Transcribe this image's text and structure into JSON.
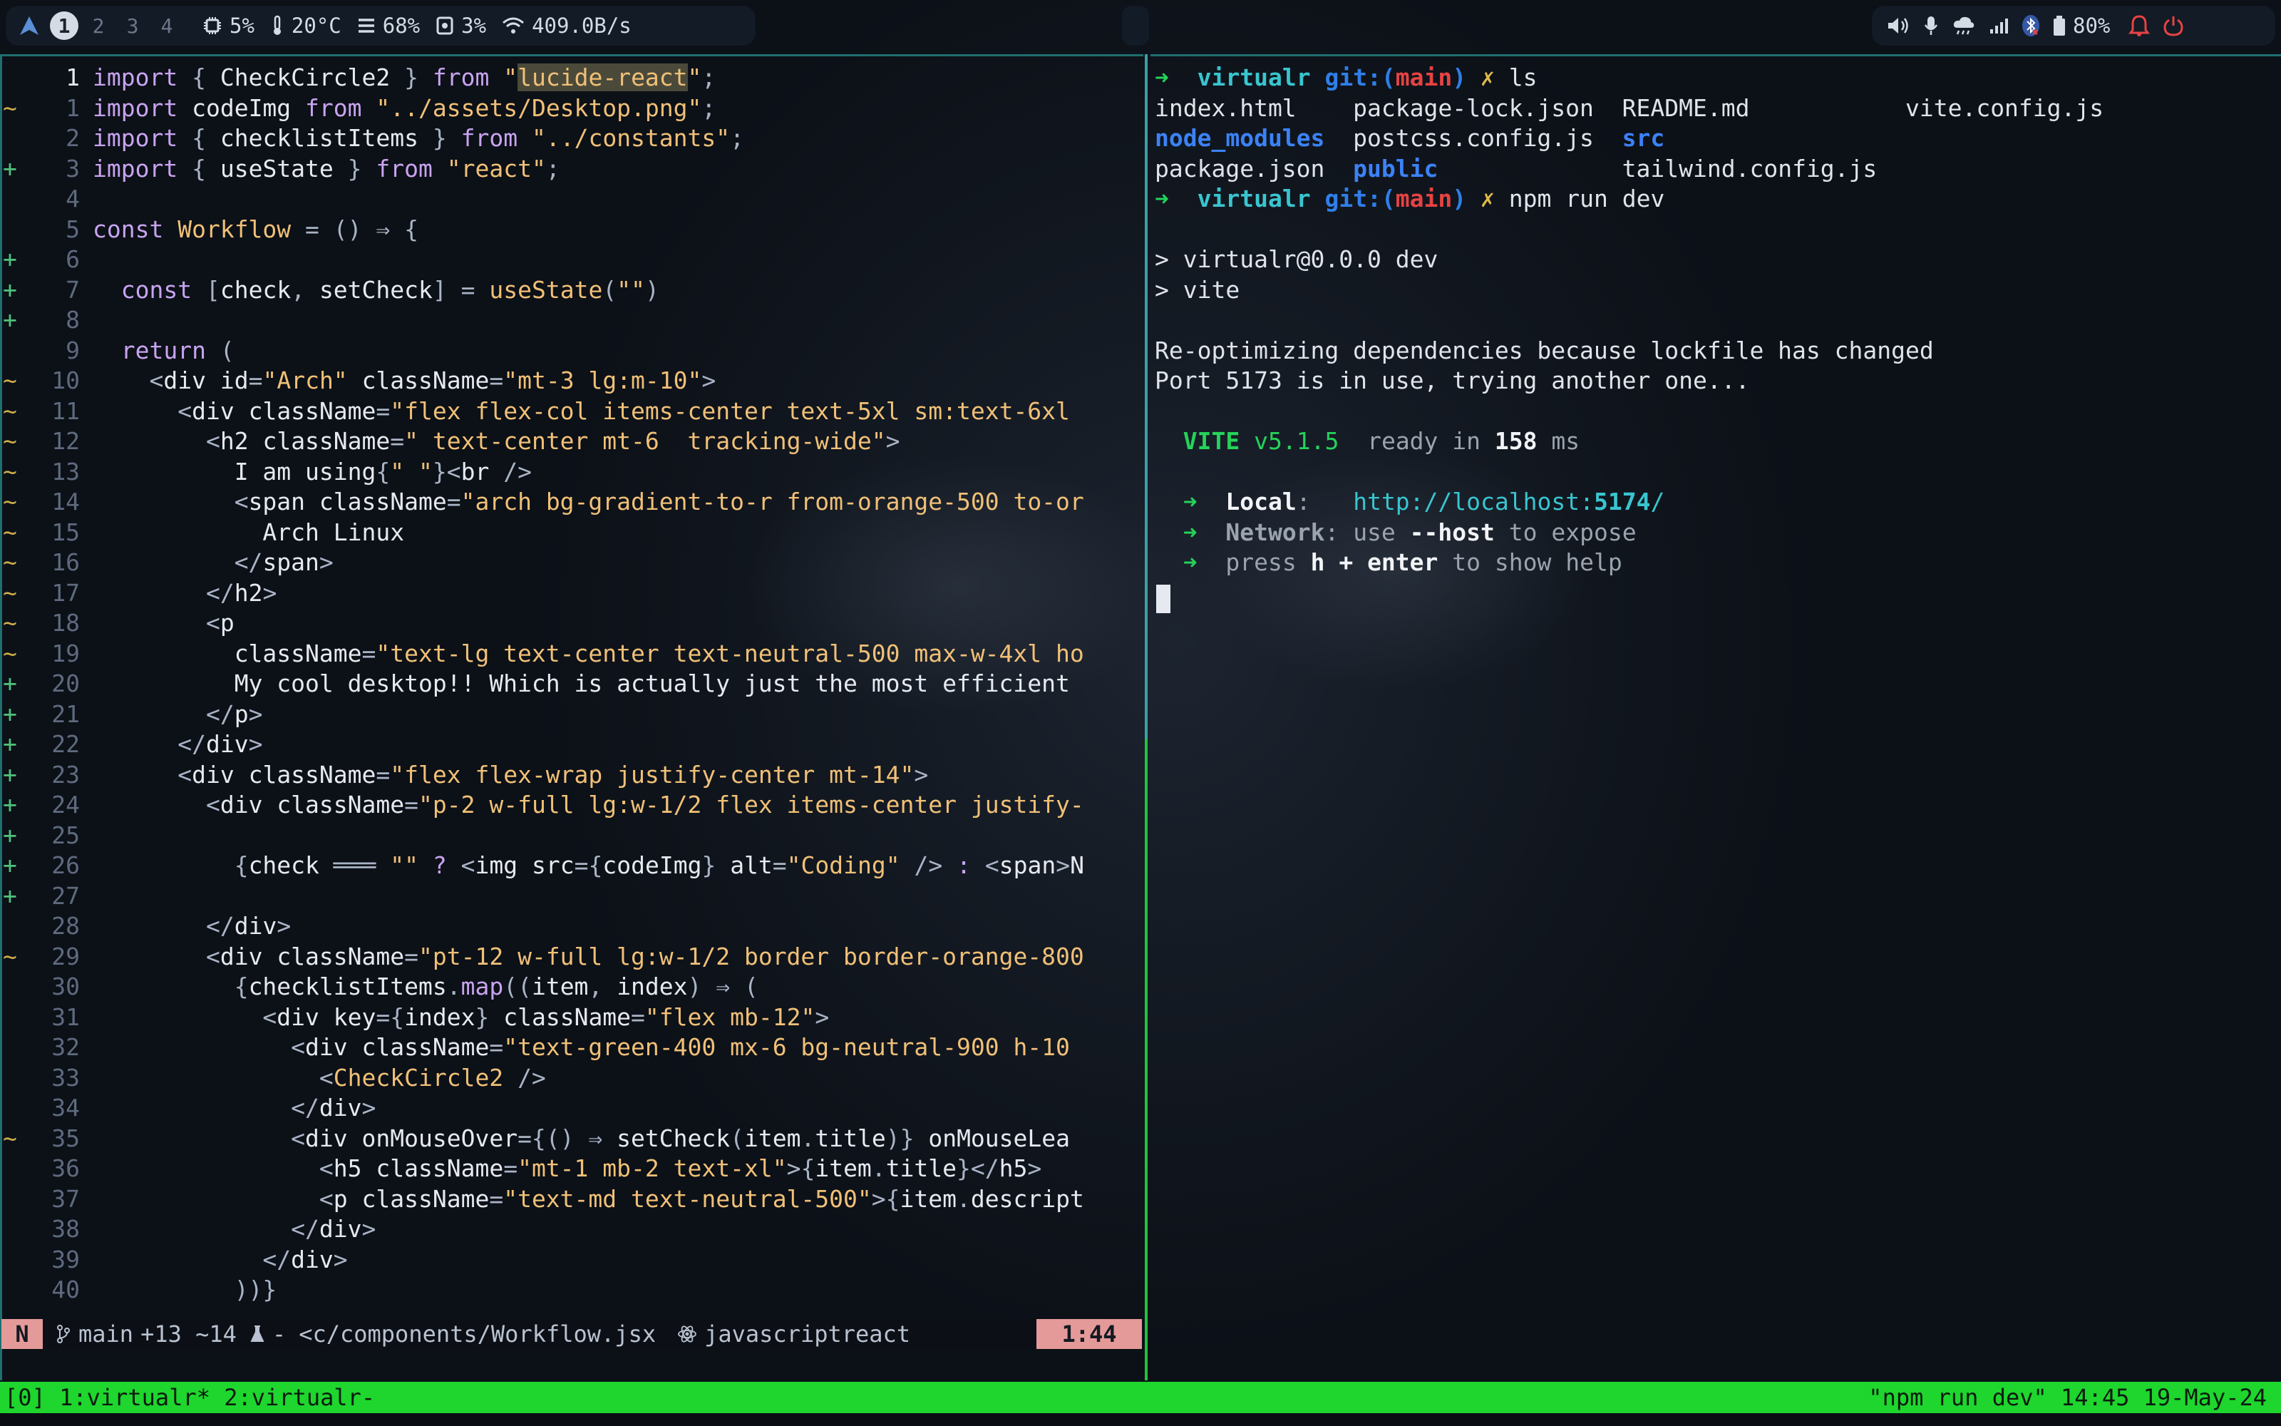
{
  "topbar": {
    "workspaces": [
      "1",
      "2",
      "3",
      "4"
    ],
    "cpu": "5%",
    "temp": "20°C",
    "memory": "68%",
    "disk": "3%",
    "network": "409.0B/s",
    "battery": "80%"
  },
  "editor": {
    "lines": [
      {
        "sign": "",
        "num": "1",
        "html": "<span class=\"kw\">import</span> <span class=\"punc\">{</span> <span class=\"pl\">CheckCircle2</span> <span class=\"punc\">}</span> <span class=\"kw\">from</span> <span class=\"str\">\"</span><span class=\"hl\">lucide-react</span><span class=\"str\">\"</span><span class=\"punc\">;</span>"
      },
      {
        "sign": "~",
        "num": "1",
        "html": "<span class=\"kw\">import</span> <span class=\"pl\">codeImg</span> <span class=\"kw\">from</span> <span class=\"str\">\"../assets/Desktop.png\"</span><span class=\"punc\">;</span>"
      },
      {
        "sign": "",
        "num": "2",
        "html": "<span class=\"kw\">import</span> <span class=\"punc\">{</span> <span class=\"pl\">checklistItems</span> <span class=\"punc\">}</span> <span class=\"kw\">from</span> <span class=\"str\">\"../constants\"</span><span class=\"punc\">;</span>"
      },
      {
        "sign": "+",
        "num": "3",
        "html": "<span class=\"kw\">import</span> <span class=\"punc\">{</span> <span class=\"pl\">useState</span> <span class=\"punc\">}</span> <span class=\"kw\">from</span> <span class=\"str\">\"react\"</span><span class=\"punc\">;</span>"
      },
      {
        "sign": "",
        "num": "4",
        "html": ""
      },
      {
        "sign": "",
        "num": "5",
        "html": "<span class=\"kw\">const</span> <span class=\"str\">Workflow</span> <span class=\"punc\">=</span> <span class=\"punc\">()</span> <span class=\"punc\">⇒</span> <span class=\"punc\">{</span>"
      },
      {
        "sign": "+",
        "num": "6",
        "html": ""
      },
      {
        "sign": "+",
        "num": "7",
        "html": "  <span class=\"kw\">const</span> <span class=\"punc\">[</span><span class=\"pl\">check</span><span class=\"punc\">,</span> <span class=\"pl\">setCheck</span><span class=\"punc\">]</span> <span class=\"punc\">=</span> <span class=\"str\">useState</span><span class=\"punc\">(</span><span class=\"str\">\"\"</span><span class=\"punc\">)</span>"
      },
      {
        "sign": "+",
        "num": "8",
        "html": ""
      },
      {
        "sign": "",
        "num": "9",
        "html": "  <span class=\"kw\">return</span> <span class=\"punc\">(</span>"
      },
      {
        "sign": "~",
        "num": "10",
        "html": "    <span class=\"punc\">&lt;</span><span class=\"tag\">div</span> <span class=\"attr\">id</span><span class=\"punc\">=</span><span class=\"str\">\"Arch\"</span> <span class=\"attr\">className</span><span class=\"punc\">=</span><span class=\"str\">\"mt-3 lg:m-10\"</span><span class=\"punc\">&gt;</span>"
      },
      {
        "sign": "~",
        "num": "11",
        "html": "      <span class=\"punc\">&lt;</span><span class=\"tag\">div</span> <span class=\"attr\">className</span><span class=\"punc\">=</span><span class=\"str\">\"flex flex-col items-center text-5xl sm:text-6xl</span>"
      },
      {
        "sign": "~",
        "num": "12",
        "html": "        <span class=\"punc\">&lt;</span><span class=\"tag\">h2</span> <span class=\"attr\">className</span><span class=\"punc\">=</span><span class=\"str\">\" text-center mt-6  tracking-wide\"</span><span class=\"punc\">&gt;</span>"
      },
      {
        "sign": "~",
        "num": "13",
        "html": "          <span class=\"pl\">I am using</span><span class=\"punc\">{</span><span class=\"str\">\" \"</span><span class=\"punc\">}&lt;</span><span class=\"tag\">br</span> <span class=\"punc\">/&gt;</span>"
      },
      {
        "sign": "~",
        "num": "14",
        "html": "          <span class=\"punc\">&lt;</span><span class=\"tag\">span</span> <span class=\"attr\">className</span><span class=\"punc\">=</span><span class=\"str\">\"arch bg-gradient-to-r from-orange-500 to-or</span>"
      },
      {
        "sign": "~",
        "num": "15",
        "html": "            <span class=\"pl\">Arch Linux</span>"
      },
      {
        "sign": "~",
        "num": "16",
        "html": "          <span class=\"punc\">&lt;/</span><span class=\"tag\">span</span><span class=\"punc\">&gt;</span>"
      },
      {
        "sign": "~",
        "num": "17",
        "html": "        <span class=\"punc\">&lt;/</span><span class=\"tag\">h2</span><span class=\"punc\">&gt;</span>"
      },
      {
        "sign": "~",
        "num": "18",
        "html": "        <span class=\"punc\">&lt;</span><span class=\"tag\">p</span>"
      },
      {
        "sign": "~",
        "num": "19",
        "html": "          <span class=\"attr\">className</span><span class=\"punc\">=</span><span class=\"str\">\"text-lg text-center text-neutral-500 max-w-4xl ho</span>"
      },
      {
        "sign": "+",
        "num": "20",
        "html": "          <span class=\"pl\">My cool desktop!! Which is actually just the most efficient</span>"
      },
      {
        "sign": "+",
        "num": "21",
        "html": "        <span class=\"punc\">&lt;/</span><span class=\"tag\">p</span><span class=\"punc\">&gt;</span>"
      },
      {
        "sign": "+",
        "num": "22",
        "html": "      <span class=\"punc\">&lt;/</span><span class=\"tag\">div</span><span class=\"punc\">&gt;</span>"
      },
      {
        "sign": "+",
        "num": "23",
        "html": "      <span class=\"punc\">&lt;</span><span class=\"tag\">div</span> <span class=\"attr\">className</span><span class=\"punc\">=</span><span class=\"str\">\"flex flex-wrap justify-center mt-14\"</span><span class=\"punc\">&gt;</span>"
      },
      {
        "sign": "+",
        "num": "24",
        "html": "        <span class=\"punc\">&lt;</span><span class=\"tag\">div</span> <span class=\"attr\">className</span><span class=\"punc\">=</span><span class=\"str\">\"p-2 w-full lg:w-1/2 flex items-center justify-</span>"
      },
      {
        "sign": "+",
        "num": "25",
        "html": ""
      },
      {
        "sign": "+",
        "num": "26",
        "html": "          <span class=\"punc\">{</span><span class=\"pl\">check</span> <span class=\"punc\">═══</span> <span class=\"str\">\"\"</span> <span class=\"kw\">?</span> <span class=\"punc\">&lt;</span><span class=\"tag\">img</span> <span class=\"attr\">src</span><span class=\"punc\">={</span><span class=\"pl\">codeImg</span><span class=\"punc\">}</span> <span class=\"attr\">alt</span><span class=\"punc\">=</span><span class=\"str\">\"Coding\"</span> <span class=\"punc\">/&gt;</span> <span class=\"kw\">:</span> <span class=\"punc\">&lt;</span><span class=\"tag\">span</span><span class=\"punc\">&gt;</span><span class=\"pl\">N</span>"
      },
      {
        "sign": "+",
        "num": "27",
        "html": ""
      },
      {
        "sign": "",
        "num": "28",
        "html": "        <span class=\"punc\">&lt;/</span><span class=\"tag\">div</span><span class=\"punc\">&gt;</span>"
      },
      {
        "sign": "~",
        "num": "29",
        "html": "        <span class=\"punc\">&lt;</span><span class=\"tag\">div</span> <span class=\"attr\">className</span><span class=\"punc\">=</span><span class=\"str\">\"pt-12 w-full lg:w-1/2 border border-orange-800</span>"
      },
      {
        "sign": "",
        "num": "30",
        "html": "          <span class=\"punc\">{</span><span class=\"pl\">checklistItems</span><span class=\"punc\">.</span><span class=\"kw\">map</span><span class=\"punc\">((</span><span class=\"pl\">item</span><span class=\"punc\">,</span> <span class=\"pl\">index</span><span class=\"punc\">)</span> <span class=\"punc\">⇒</span> <span class=\"punc\">(</span>"
      },
      {
        "sign": "",
        "num": "31",
        "html": "            <span class=\"punc\">&lt;</span><span class=\"tag\">div</span> <span class=\"attr\">key</span><span class=\"punc\">={</span><span class=\"pl\">index</span><span class=\"punc\">}</span> <span class=\"attr\">className</span><span class=\"punc\">=</span><span class=\"str\">\"flex mb-12\"</span><span class=\"punc\">&gt;</span>"
      },
      {
        "sign": "",
        "num": "32",
        "html": "              <span class=\"punc\">&lt;</span><span class=\"tag\">div</span> <span class=\"attr\">className</span><span class=\"punc\">=</span><span class=\"str\">\"text-green-400 mx-6 bg-neutral-900 h-10</span>"
      },
      {
        "sign": "",
        "num": "33",
        "html": "                <span class=\"punc\">&lt;</span><span class=\"str\">CheckCircle2</span> <span class=\"punc\">/&gt;</span>"
      },
      {
        "sign": "",
        "num": "34",
        "html": "              <span class=\"punc\">&lt;/</span><span class=\"tag\">div</span><span class=\"punc\">&gt;</span>"
      },
      {
        "sign": "~",
        "num": "35",
        "html": "              <span class=\"punc\">&lt;</span><span class=\"tag\">div</span> <span class=\"attr\">onMouseOver</span><span class=\"punc\">={()</span> <span class=\"punc\">⇒</span> <span class=\"pl\">setCheck</span><span class=\"punc\">(</span><span class=\"pl\">item</span><span class=\"punc\">.</span><span class=\"pl\">title</span><span class=\"punc\">)}</span> <span class=\"attr\">onMouseLea</span>"
      },
      {
        "sign": "",
        "num": "36",
        "html": "                <span class=\"punc\">&lt;</span><span class=\"tag\">h5</span> <span class=\"attr\">className</span><span class=\"punc\">=</span><span class=\"str\">\"mt-1 mb-2 text-xl\"</span><span class=\"punc\">&gt;{</span><span class=\"pl\">item</span><span class=\"punc\">.</span><span class=\"pl\">title</span><span class=\"punc\">}&lt;/</span><span class=\"tag\">h5</span><span class=\"punc\">&gt;</span>"
      },
      {
        "sign": "",
        "num": "37",
        "html": "                <span class=\"punc\">&lt;</span><span class=\"tag\">p</span> <span class=\"attr\">className</span><span class=\"punc\">=</span><span class=\"str\">\"text-md text-neutral-500\"</span><span class=\"punc\">&gt;{</span><span class=\"pl\">item</span><span class=\"punc\">.</span><span class=\"pl\">descript</span>"
      },
      {
        "sign": "",
        "num": "38",
        "html": "              <span class=\"punc\">&lt;/</span><span class=\"tag\">div</span><span class=\"punc\">&gt;</span>"
      },
      {
        "sign": "",
        "num": "39",
        "html": "            <span class=\"punc\">&lt;/</span><span class=\"tag\">div</span><span class=\"punc\">&gt;</span>"
      },
      {
        "sign": "",
        "num": "40",
        "html": "          <span class=\"punc\">))}</span>"
      }
    ],
    "status": {
      "mode": "N",
      "branch": "main",
      "diff": "+13 ~14",
      "flask": "-",
      "file": "<c/components/Workflow.jsx",
      "filetype": "javascriptreact",
      "position": "1:44"
    }
  },
  "terminal": {
    "lines": [
      {
        "html": "<span class=\"prompt-arrow\">➜</span>  <span class=\"pdir\">virtualr</span> <span class=\"pgit\">git:(</span><span class=\"pbranch\">main</span><span class=\"pgit\">)</span> <span class=\"px\">✗</span> ls"
      },
      {
        "html": "index.html    package-lock.json  README.md           vite.config.js"
      },
      {
        "html": "<span class=\"dirc\">node_modules</span>  postcss.config.js  <span class=\"dirc\">src</span>"
      },
      {
        "html": "package.json  <span class=\"dirc\">public</span>             tailwind.config.js"
      },
      {
        "html": "<span class=\"prompt-arrow\">➜</span>  <span class=\"pdir\">virtualr</span> <span class=\"pgit\">git:(</span><span class=\"pbranch\">main</span><span class=\"pgit\">)</span> <span class=\"px\">✗</span> npm run dev"
      },
      {
        "html": ""
      },
      {
        "html": "&gt; virtualr@0.0.0 dev"
      },
      {
        "html": "&gt; vite"
      },
      {
        "html": ""
      },
      {
        "html": "Re-optimizing dependencies because lockfile has changed"
      },
      {
        "html": "Port 5173 is in use, trying another one..."
      },
      {
        "html": ""
      },
      {
        "html": "  <span class=\"vite\">VITE</span> <span class=\"vite\" style=\"font-weight:normal\">v5.1.5</span>  <span class=\"dim\">ready in</span> <span class=\"bold\">158</span> <span class=\"dim\">ms</span>"
      },
      {
        "html": ""
      },
      {
        "html": "  <span class=\"prompt-arrow\">➜</span>  <span class=\"bold\">Local</span><span class=\"dim\">:</span>   <span class=\"url\">http://localhost:<b>5174</b>/</span>"
      },
      {
        "html": "  <span class=\"prompt-arrow\">➜</span>  <span class=\"dim\"><b>Network</b>: use </span><span class=\"bold\">--host</span><span class=\"dim\"> to expose</span>"
      },
      {
        "html": "  <span class=\"prompt-arrow\">➜</span>  <span class=\"dim\">press </span><span class=\"bold\">h + enter</span><span class=\"dim\"> to show help</span>"
      }
    ]
  },
  "tmux": {
    "left": "[0] 1:virtualr* 2:virtualr-",
    "right": "\"npm run dev\" 14:45 19-May-24"
  },
  "colors": {
    "tmux_bg": "#1ed62e",
    "accent_green": "#25d35a",
    "mode_bg": "#e59a9a"
  }
}
